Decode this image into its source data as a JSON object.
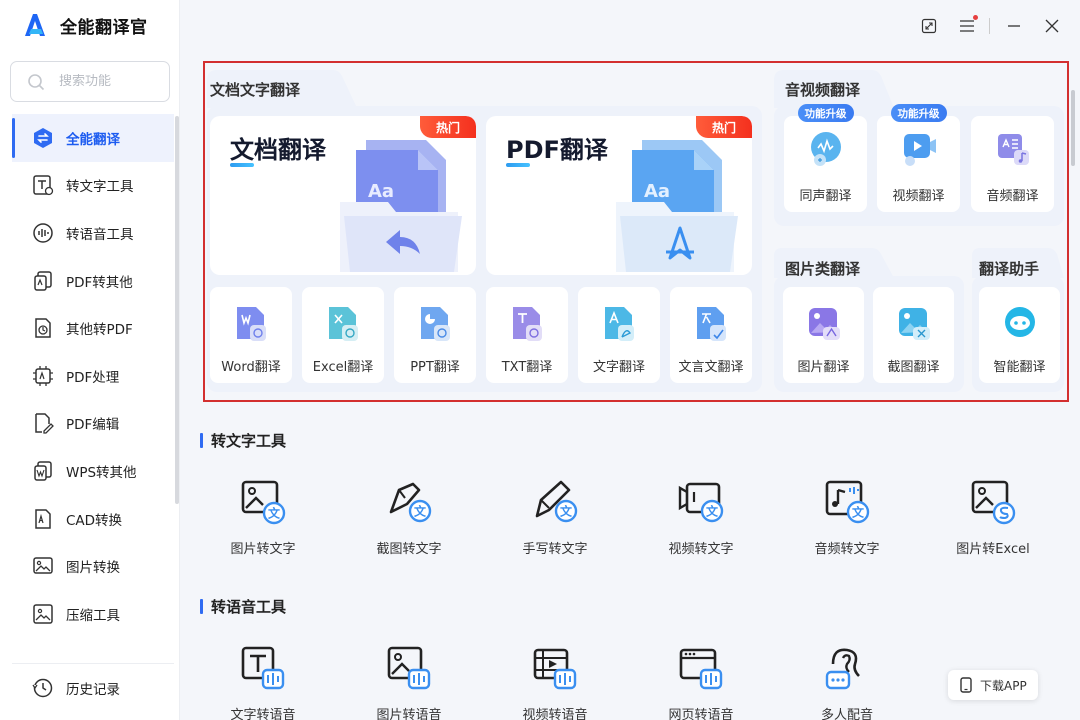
{
  "app": {
    "title": "全能翻译官"
  },
  "search": {
    "placeholder": "搜索功能"
  },
  "sidebar": {
    "items": [
      {
        "label": "全能翻译",
        "active": true,
        "icon": "translate-icon"
      },
      {
        "label": "转文字工具",
        "icon": "text-tool-icon"
      },
      {
        "label": "转语音工具",
        "icon": "voice-tool-icon"
      },
      {
        "label": "PDF转其他",
        "icon": "pdf-convert-icon"
      },
      {
        "label": "其他转PDF",
        "icon": "to-pdf-icon"
      },
      {
        "label": "PDF处理",
        "icon": "pdf-process-icon"
      },
      {
        "label": "PDF编辑",
        "icon": "pdf-edit-icon"
      },
      {
        "label": "WPS转其他",
        "icon": "wps-icon"
      },
      {
        "label": "CAD转换",
        "icon": "cad-icon"
      },
      {
        "label": "图片转换",
        "icon": "image-convert-icon"
      },
      {
        "label": "压缩工具",
        "icon": "compress-icon"
      }
    ],
    "history": "历史记录"
  },
  "translate": {
    "doc_section": "文档文字翻译",
    "big_cards": [
      {
        "title": "文档翻译",
        "badge": "热门"
      },
      {
        "title": "PDF翻译",
        "badge": "热门"
      }
    ],
    "doc_tiles": [
      "Word翻译",
      "Excel翻译",
      "PPT翻译",
      "TXT翻译",
      "文字翻译",
      "文言文翻译"
    ],
    "av_section": "音视频翻译",
    "av_tiles": [
      {
        "label": "同声翻译",
        "badge": "功能升级"
      },
      {
        "label": "视频翻译",
        "badge": "功能升级"
      },
      {
        "label": "音频翻译"
      }
    ],
    "img_section": "图片类翻译",
    "img_tiles": [
      "图片翻译",
      "截图翻译"
    ],
    "assist_section": "翻译助手",
    "assist_tiles": [
      "智能翻译"
    ]
  },
  "text_tools": {
    "title": "转文字工具",
    "items": [
      "图片转文字",
      "截图转文字",
      "手写转文字",
      "视频转文字",
      "音频转文字",
      "图片转Excel"
    ]
  },
  "voice_tools": {
    "title": "转语音工具",
    "items": [
      "文字转语音",
      "图片转语音",
      "视频转语音",
      "网页转语音",
      "多人配音"
    ]
  },
  "download": {
    "label": "下载APP"
  },
  "colors": {
    "accent": "#2f6bf2",
    "hot": "#f4301e",
    "highlight": "#d32f2f"
  }
}
